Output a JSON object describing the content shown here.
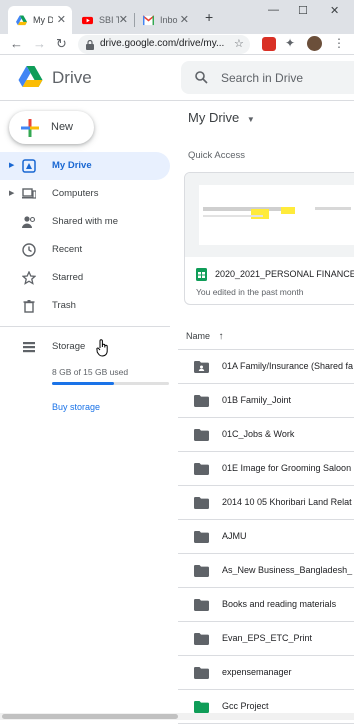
{
  "browser": {
    "tabs": [
      {
        "label": "My D",
        "icon": "google-drive-icon",
        "active": true
      },
      {
        "label": "SBI T",
        "icon": "youtube-icon",
        "active": false
      },
      {
        "label": "Inbo",
        "icon": "gmail-icon",
        "active": false
      }
    ],
    "new_tab": "+",
    "url": "drive.google.com/drive/my..."
  },
  "header": {
    "app_title": "Drive",
    "search_placeholder": "Search in Drive"
  },
  "sidebar": {
    "new_label": "New",
    "items": [
      {
        "label": "My Drive",
        "icon": "my-drive-icon",
        "active": true
      },
      {
        "label": "Computers",
        "icon": "computers-icon",
        "active": false
      },
      {
        "label": "Shared with me",
        "icon": "shared-icon",
        "active": false
      },
      {
        "label": "Recent",
        "icon": "clock-icon",
        "active": false
      },
      {
        "label": "Starred",
        "icon": "star-icon",
        "active": false
      },
      {
        "label": "Trash",
        "icon": "trash-icon",
        "active": false
      }
    ],
    "storage": {
      "label": "Storage",
      "usage_text": "8 GB of 15 GB used",
      "used_fraction": 0.53,
      "buy_label": "Buy storage"
    }
  },
  "main": {
    "title": "My Drive",
    "quick_access_label": "Quick Access",
    "quick_access_card": {
      "name": "2020_2021_PERSONAL FINANCE...",
      "subtitle": "You edited in the past month"
    },
    "list_header": "Name",
    "files": [
      {
        "name": "01A Family/Insurance (Shared fa",
        "type": "shared-folder"
      },
      {
        "name": "01B Family_Joint",
        "type": "folder"
      },
      {
        "name": "01C_Jobs & Work",
        "type": "folder"
      },
      {
        "name": "01E Image for Grooming Saloon",
        "type": "folder"
      },
      {
        "name": "2014 10 05 Khoribari Land Relat",
        "type": "folder"
      },
      {
        "name": "AJMU",
        "type": "folder"
      },
      {
        "name": "As_New Business_Bangladesh_",
        "type": "folder"
      },
      {
        "name": "Books and reading materials",
        "type": "folder"
      },
      {
        "name": "Evan_EPS_ETC_Print",
        "type": "folder"
      },
      {
        "name": "expensemanager",
        "type": "folder"
      },
      {
        "name": "Gcc Project",
        "type": "folder-green"
      }
    ]
  },
  "colors": {
    "accent": "#1a73e8",
    "active_bg": "#e8f0fe",
    "active_text": "#1967d2",
    "folder": "#5f6368",
    "folder_green": "#0f9d58"
  }
}
